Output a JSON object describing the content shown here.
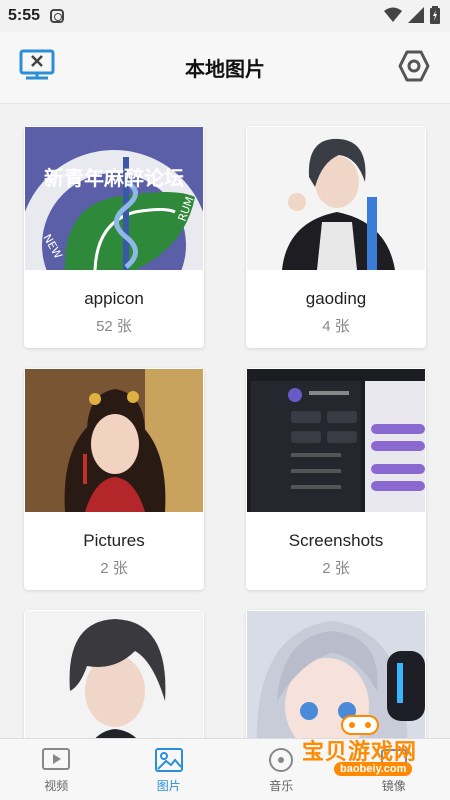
{
  "status": {
    "time": "5:55"
  },
  "header": {
    "title": "本地图片"
  },
  "albums": [
    {
      "name": "appicon",
      "count": "52 张",
      "logo_text": "新青年麻醉论坛"
    },
    {
      "name": "gaoding",
      "count": "4 张"
    },
    {
      "name": "Pictures",
      "count": "2 张"
    },
    {
      "name": "Screenshots",
      "count": "2 张"
    },
    {
      "name": "",
      "count": ""
    },
    {
      "name": "",
      "count": ""
    }
  ],
  "nav": [
    {
      "label": "视频",
      "icon": "video-icon",
      "active": false
    },
    {
      "label": "图片",
      "icon": "image-icon",
      "active": true
    },
    {
      "label": "音乐",
      "icon": "music-icon",
      "active": false
    },
    {
      "label": "镜像",
      "icon": "mirror-icon",
      "active": false
    }
  ],
  "watermark": {
    "text": "宝贝游戏网",
    "url": "baobeiy.com"
  },
  "colors": {
    "accent": "#2b8fd8",
    "watermark": "#ff8a00"
  }
}
